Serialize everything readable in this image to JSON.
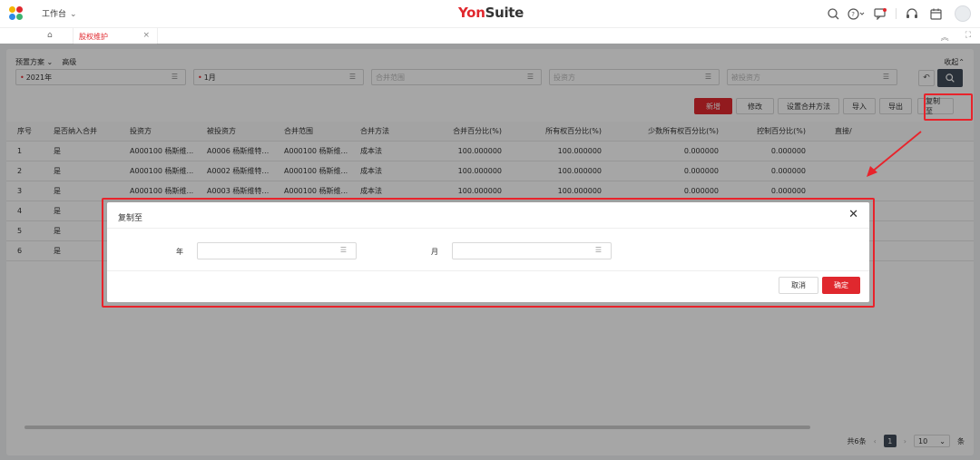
{
  "topbar": {
    "workbench_label": "工作台",
    "brand_yon": "Yon",
    "brand_suite": "Suite",
    "icons": [
      "search-icon",
      "help-icon",
      "message-icon",
      "service-icon",
      "calendar-icon",
      "avatar"
    ]
  },
  "tabs": {
    "active_label": "股权维护",
    "close": "×"
  },
  "scheme": {
    "preset_label": "预置方案",
    "advanced_label": "高级",
    "collapse_label": "收起"
  },
  "filters": [
    {
      "value": "2021年",
      "required": true
    },
    {
      "value": "1月",
      "required": true
    },
    {
      "placeholder": "合并范围"
    },
    {
      "placeholder": "投资方"
    },
    {
      "placeholder": "被投资方"
    }
  ],
  "actions": {
    "add": "新增",
    "edit": "修改",
    "set_method": "设置合并方法",
    "import": "导入",
    "export": "导出",
    "copy_to": "复制至"
  },
  "table": {
    "headers": [
      "序号",
      "是否纳入合并",
      "投资方",
      "被投资方",
      "合并范围",
      "合并方法",
      "合并百分比(%)",
      "所有权百分比(%)",
      "少数所有权百分比(%)",
      "控制百分比(%)",
      "直接/"
    ],
    "rows": [
      {
        "idx": "1",
        "inc": "是",
        "inv": "A000100 杨斯维...",
        "invd": "A0006 杨斯维特医...",
        "scope": "A000100 杨斯维...",
        "method": "成本法",
        "pct": "100.000000",
        "own": "100.000000",
        "min": "0.000000",
        "ctrl": "0.000000"
      },
      {
        "idx": "2",
        "inc": "是",
        "inv": "A000100 杨斯维...",
        "invd": "A0002 杨斯维特置...",
        "scope": "A000100 杨斯维...",
        "method": "成本法",
        "pct": "100.000000",
        "own": "100.000000",
        "min": "0.000000",
        "ctrl": "0.000000"
      },
      {
        "idx": "3",
        "inc": "是",
        "inv": "A000100 杨斯维...",
        "invd": "A0003 杨斯维特食...",
        "scope": "A000100 杨斯维...",
        "method": "成本法",
        "pct": "100.000000",
        "own": "100.000000",
        "min": "0.000000",
        "ctrl": "0.000000"
      },
      {
        "idx": "4",
        "inc": "是",
        "inv": "",
        "invd": "",
        "scope": "",
        "method": "",
        "pct": "",
        "own": "",
        "min": "",
        "ctrl": ""
      },
      {
        "idx": "5",
        "inc": "是",
        "inv": "",
        "invd": "",
        "scope": "",
        "method": "",
        "pct": "",
        "own": "",
        "min": "",
        "ctrl": ""
      },
      {
        "idx": "6",
        "inc": "是",
        "inv": "",
        "invd": "",
        "scope": "",
        "method": "",
        "pct": "",
        "own": "",
        "min": "",
        "ctrl": ""
      }
    ]
  },
  "pager": {
    "total": "共6条",
    "current_page": "1",
    "page_size": "10",
    "unit": "条"
  },
  "dialog": {
    "title": "复制至",
    "year_label": "年",
    "month_label": "月",
    "cancel": "取消",
    "ok": "确定"
  },
  "colors": {
    "brand_red": "#e0282e",
    "highlight_red": "#e8232b",
    "dark_button": "#414c5a"
  }
}
